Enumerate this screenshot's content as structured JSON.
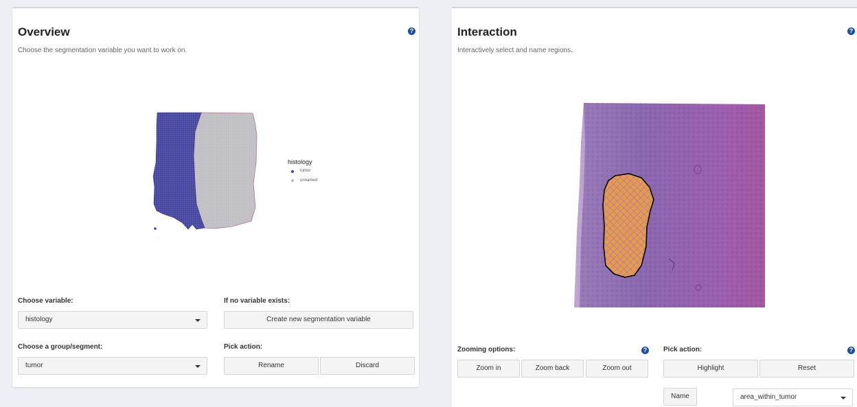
{
  "overview": {
    "title": "Overview",
    "subtitle": "Choose the segmentation variable you want to work on.",
    "help_glyph": "?",
    "plot": {
      "legend_title": "histology",
      "legend": [
        {
          "label": "tumor",
          "color": "#3f3f9c"
        },
        {
          "label": "unnamed",
          "color": "#bdbcc1"
        }
      ]
    },
    "choose_variable_label": "Choose variable:",
    "variable_value": "histology",
    "no_variable_label": "If no variable exists:",
    "create_button": "Create new segmentation variable",
    "choose_group_label": "Choose a group/segment:",
    "group_value": "tumor",
    "pick_action_label": "Pick action:",
    "rename_button": "Rename",
    "discard_button": "Discard"
  },
  "interaction": {
    "title": "Interaction",
    "subtitle": "Interactively select and name regions.",
    "help_glyph": "?",
    "zoom_label": "Zooming options:",
    "zoom_in": "Zoom in",
    "zoom_back": "Zoom back",
    "zoom_out": "Zoom out",
    "pick_action_label": "Pick action:",
    "highlight_button": "Highlight",
    "reset_button": "Reset",
    "name_button": "Name",
    "name_value": "area_within_tumor"
  },
  "icons": {
    "help": "question-circle-icon",
    "dropdown": "chevron-down-icon"
  },
  "colors": {
    "background": "#ecf0f5",
    "help_icon": "#1f4e9c",
    "tumor": "#3f3f9c",
    "unnamed": "#bdbcc1",
    "tissue": "#8b5fae",
    "highlight": "#e89a4c"
  }
}
